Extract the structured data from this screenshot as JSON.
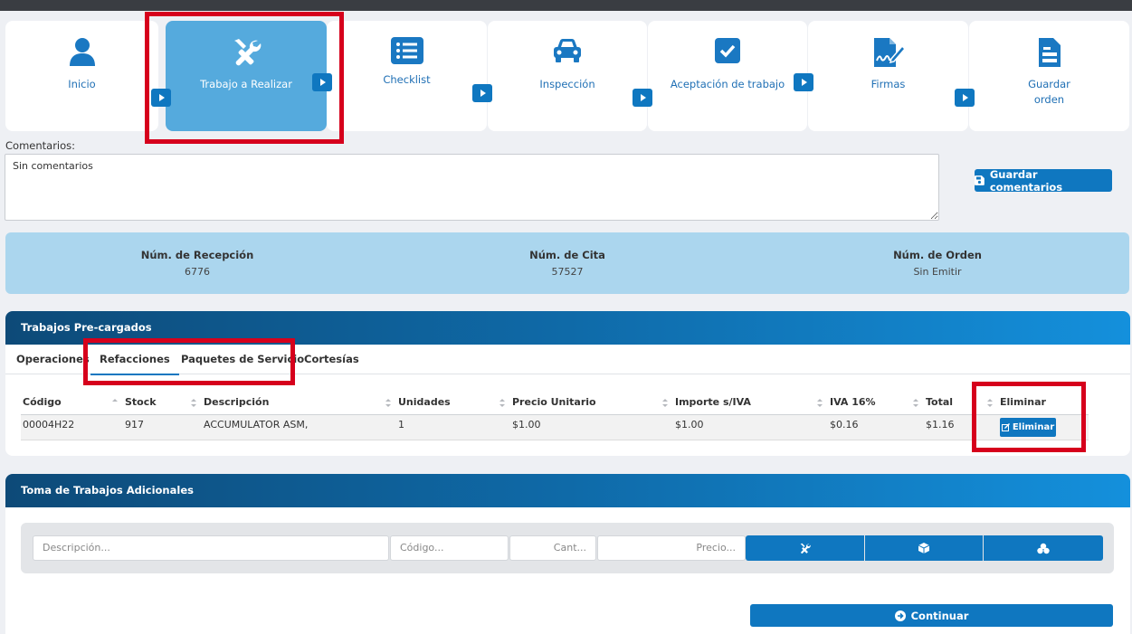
{
  "steps": [
    {
      "label": "Inicio",
      "icon": "user-icon"
    },
    {
      "label": "Trabajo a Realizar",
      "icon": "tools-icon"
    },
    {
      "label": "Checklist",
      "icon": "list-icon"
    },
    {
      "label": "Inspección",
      "icon": "car-icon"
    },
    {
      "label": "Aceptación de trabajo",
      "icon": "check-square-icon"
    },
    {
      "label": "Firmas",
      "icon": "signature-icon"
    },
    {
      "label": "Guardar orden",
      "line1": "Guardar",
      "line2": "orden",
      "icon": "document-icon"
    }
  ],
  "comments": {
    "label": "Comentarios:",
    "value": "Sin comentarios",
    "save_label": "Guardar comentarios"
  },
  "info": {
    "recepcion": {
      "title": "Núm. de Recepción",
      "value": "6776"
    },
    "cita": {
      "title": "Núm. de Cita",
      "value": "57527"
    },
    "orden": {
      "title": "Núm. de Orden",
      "value": "Sin Emitir"
    }
  },
  "precargados": {
    "title": "Trabajos Pre-cargados",
    "tabs": [
      "Operaciones",
      "Refacciones",
      "Paquetes de Servicio",
      "Cortesías"
    ],
    "active_tab": "Refacciones",
    "columns": [
      "Código",
      "Stock",
      "Descripción",
      "Unidades",
      "Precio Unitario",
      "Importe s/IVA",
      "IVA 16%",
      "Total",
      "Eliminar"
    ],
    "rows": [
      {
        "codigo": "00004H22",
        "stock": "917",
        "descripcion": "ACCUMULATOR ASM,",
        "unidades": "1",
        "precio": "$1.00",
        "importe": "$1.00",
        "iva": "$0.16",
        "total": "$1.16",
        "action": "Eliminar"
      }
    ]
  },
  "adicionales": {
    "title": "Toma de Trabajos Adicionales",
    "desc_placeholder": "Descripción...",
    "codigo_placeholder": "Código...",
    "cant_placeholder": "Cant...",
    "precio_placeholder": "Precio...",
    "continue_label": "Continuar"
  },
  "colors": {
    "accent": "#0f77c0",
    "highlight": "#d6001c",
    "active_step": "#55aadd",
    "info_panel": "#abd6ee"
  }
}
